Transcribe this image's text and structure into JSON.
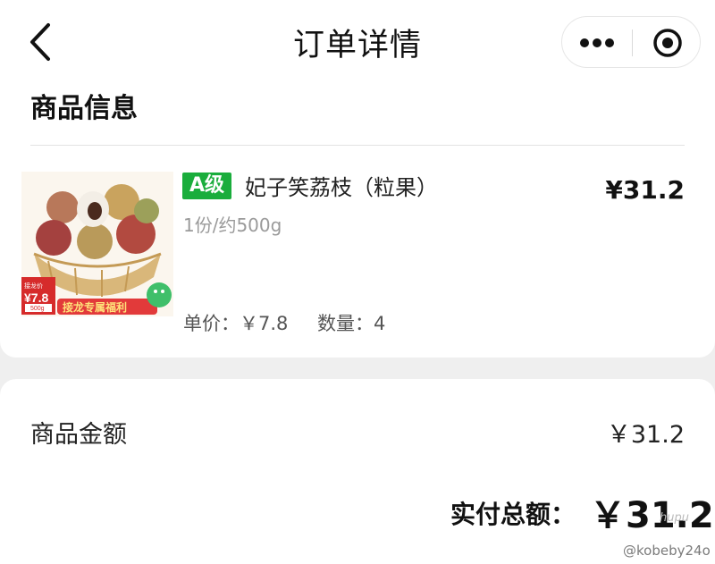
{
  "nav": {
    "title": "订单详情",
    "back_icon": "chevron-left-icon",
    "more_icon": "more-dots-icon",
    "close_icon": "target-close-icon"
  },
  "product_section": {
    "title": "商品信息",
    "item": {
      "grade": "A级",
      "name": "妃子笑荔枝（粒果）",
      "spec": "1份/约500g",
      "price": "¥31.2",
      "unit_price": "单价：￥7.8",
      "quantity": "数量：4",
      "image_label_price": "¥7.8",
      "image_label_weight": "500g",
      "image_banner": "接龙专属福利"
    }
  },
  "summary": {
    "amount_label": "商品金额",
    "amount_value": "￥31.2",
    "paid_label": "实付总额：",
    "paid_value": "￥31.2"
  },
  "watermark": {
    "logo_text": "hupu",
    "user": "@kobeby24o"
  },
  "colors": {
    "badge_green": "#1aad3c",
    "page_background": "#efefef",
    "card_background": "#ffffff"
  }
}
